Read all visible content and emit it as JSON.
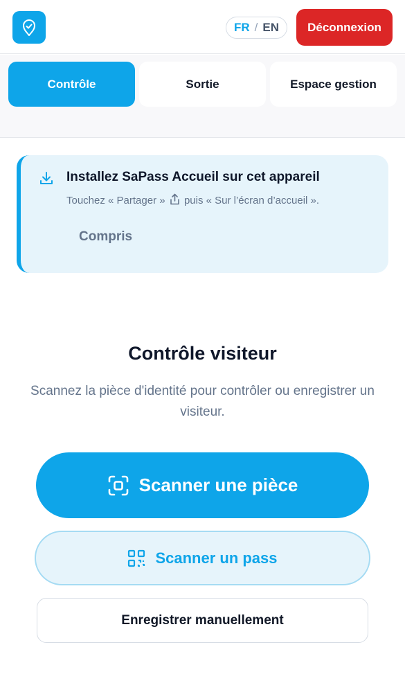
{
  "header": {
    "logo_icon": "shield-check-icon",
    "lang": {
      "fr": "FR",
      "separator": "/",
      "en": "EN",
      "active": "FR"
    },
    "logout_label": "Déconnexion"
  },
  "tabs": [
    {
      "label": "Contrôle",
      "active": true
    },
    {
      "label": "Sortie",
      "active": false
    },
    {
      "label": "Espace gestion",
      "active": false
    }
  ],
  "install_banner": {
    "icon": "download-icon",
    "title": "Installez SaPass Accueil sur cet appareil",
    "desc_before": "Touchez « Partager »",
    "desc_icon": "share-icon",
    "desc_after": "puis « Sur l’écran d’accueil ».",
    "dismiss_label": "Compris"
  },
  "main": {
    "title": "Contrôle visiteur",
    "subtitle": "Scannez la pièce d'identité pour contrôler ou enregistrer un visiteur.",
    "scan_id_label": "Scanner une pièce",
    "scan_id_icon": "scan-frame-icon",
    "scan_pass_label": "Scanner un pass",
    "scan_pass_icon": "qr-code-icon",
    "manual_label": "Enregistrer manuellement"
  },
  "colors": {
    "accent": "#0ea5e9",
    "danger": "#dc2626",
    "banner_bg": "#e6f4fb",
    "muted_text": "#64748b"
  }
}
